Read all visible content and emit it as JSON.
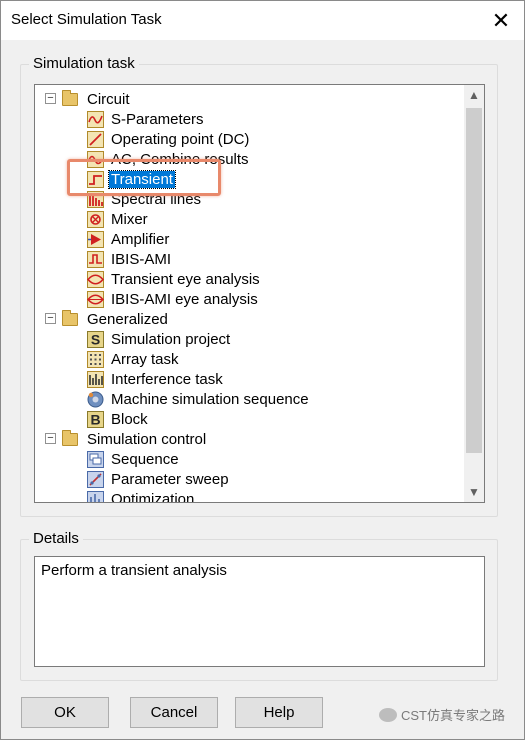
{
  "window": {
    "title": "Select Simulation Task",
    "close_glyph": "✕"
  },
  "simulation_task": {
    "legend": "Simulation task",
    "groups": [
      {
        "label": "Circuit",
        "expander": "−",
        "items": [
          {
            "label": "S-Parameters",
            "icon": "s-parameters-icon"
          },
          {
            "label": "Operating point (DC)",
            "icon": "operating-point-icon"
          },
          {
            "label": "AC, Combine results",
            "icon": "ac-icon"
          },
          {
            "label": "Transient",
            "icon": "transient-icon",
            "selected": true
          },
          {
            "label": "Spectral lines",
            "icon": "spectral-lines-icon"
          },
          {
            "label": "Mixer",
            "icon": "mixer-icon"
          },
          {
            "label": "Amplifier",
            "icon": "amplifier-icon"
          },
          {
            "label": "IBIS-AMI",
            "icon": "ibis-ami-icon"
          },
          {
            "label": "Transient eye analysis",
            "icon": "eye-analysis-icon"
          },
          {
            "label": "IBIS-AMI eye analysis",
            "icon": "ibis-eye-icon"
          }
        ]
      },
      {
        "label": "Generalized",
        "expander": "−",
        "items": [
          {
            "label": "Simulation project",
            "icon": "simulation-project-icon",
            "glyph": "S"
          },
          {
            "label": "Array task",
            "icon": "array-task-icon"
          },
          {
            "label": "Interference task",
            "icon": "interference-task-icon"
          },
          {
            "label": "Machine simulation sequence",
            "icon": "machine-sequence-icon"
          },
          {
            "label": "Block",
            "icon": "block-icon",
            "glyph": "B"
          }
        ]
      },
      {
        "label": "Simulation control",
        "expander": "−",
        "items": [
          {
            "label": "Sequence",
            "icon": "sequence-icon"
          },
          {
            "label": "Parameter sweep",
            "icon": "parameter-sweep-icon"
          },
          {
            "label": "Optimization",
            "icon": "optimization-icon"
          }
        ]
      }
    ],
    "scroll_up": "▲",
    "scroll_down": "▼"
  },
  "details": {
    "legend": "Details",
    "text": "Perform a transient analysis"
  },
  "buttons": {
    "ok": "OK",
    "cancel": "Cancel",
    "help": "Help"
  },
  "watermark": {
    "text": "CST仿真专家之路"
  },
  "colors": {
    "selection": "#0078d7",
    "highlight_box": "#e8896b",
    "dialog_bg": "#f0f0f0"
  }
}
